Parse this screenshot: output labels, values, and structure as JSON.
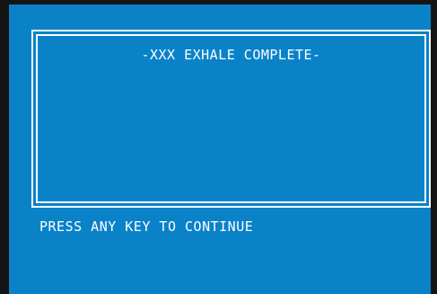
{
  "dialog": {
    "title": "-XXX EXHALE COMPLETE-"
  },
  "prompt": {
    "text": "PRESS ANY KEY TO CONTINUE"
  },
  "colors": {
    "screen_background": "#0a82c8",
    "text": "#ffffff",
    "bezel": "#141414"
  }
}
